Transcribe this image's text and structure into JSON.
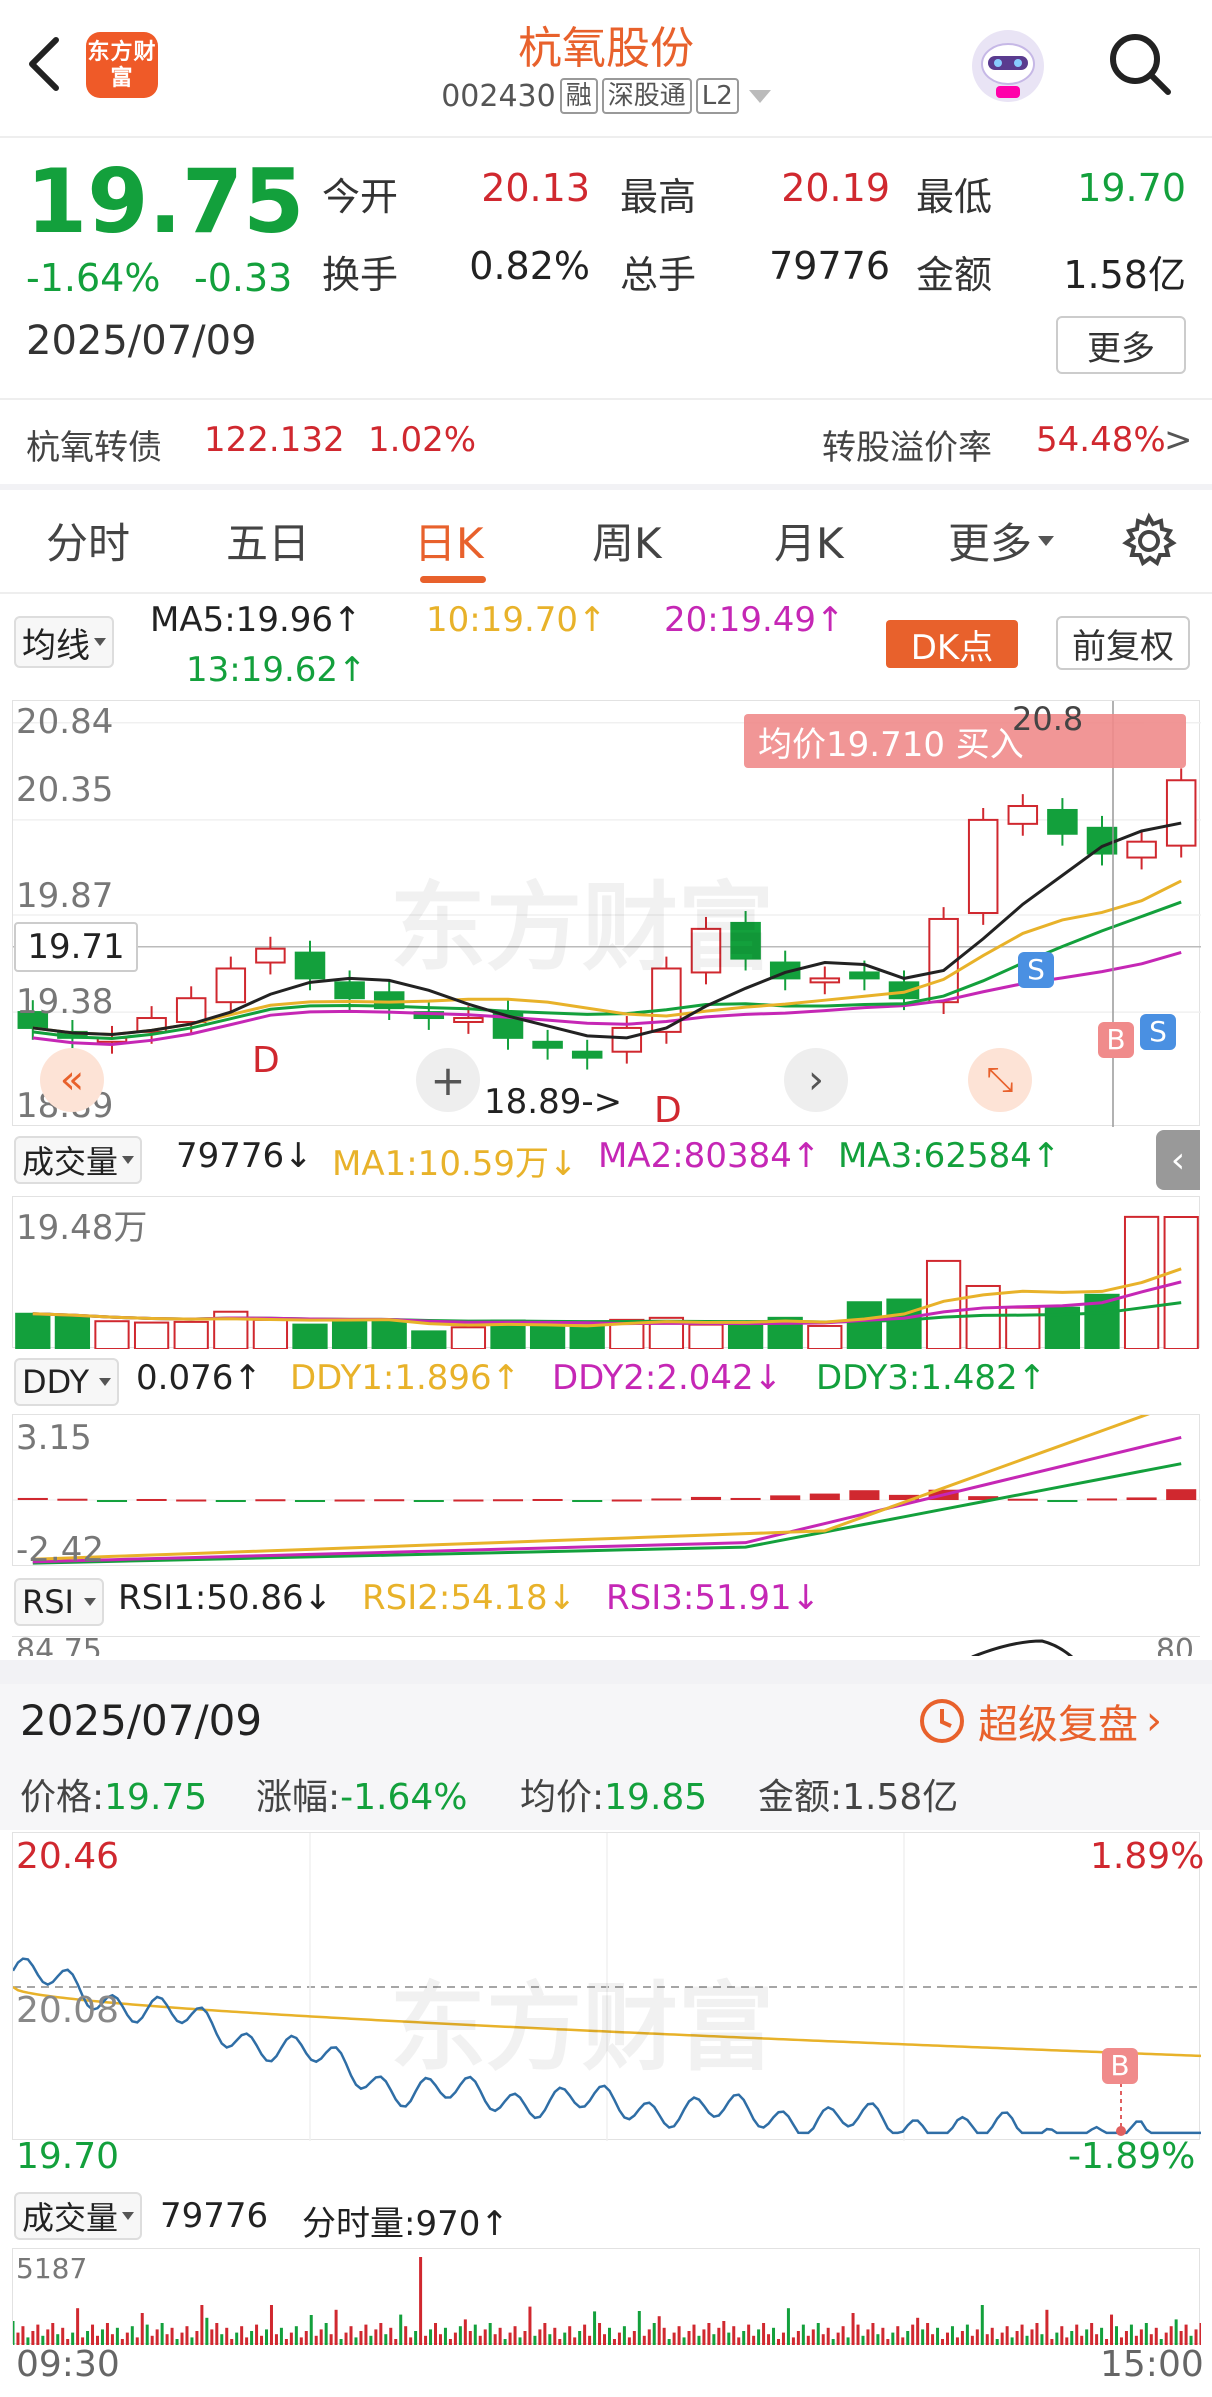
{
  "header": {
    "title": "杭氧股份",
    "code": "002430",
    "tags": [
      "融",
      "深股通",
      "L2"
    ],
    "logo_text": "东方财富"
  },
  "quote": {
    "price": "19.75",
    "change_pct": "-1.64%",
    "change": "-0.33",
    "date": "2025/07/09",
    "open_label": "今开",
    "open": "20.13",
    "high_label": "最高",
    "high": "20.19",
    "low_label": "最低",
    "low": "19.70",
    "turnover_label": "换手",
    "turnover": "0.82%",
    "volume_label": "总手",
    "volume": "79776",
    "amount_label": "金额",
    "amount": "1.58亿",
    "more": "更多"
  },
  "bond": {
    "name": "杭氧转债",
    "price": "122.132",
    "change": "1.02%",
    "premium_label": "转股溢价率",
    "premium": "54.48%",
    "arrow": ">"
  },
  "tabs": [
    "分时",
    "五日",
    "日K",
    "周K",
    "月K",
    "更多"
  ],
  "kline": {
    "indicator": "均线",
    "ma5": "MA5:19.96↑",
    "ma10": "10:19.70↑",
    "ma20": "20:19.49↑",
    "ma13": "13:19.62↑",
    "dk": "DK点",
    "adjust": "前复权",
    "avg_label": "均价19.710  买入",
    "top_partial": "20.8",
    "y_labels": [
      "20.84",
      "20.35",
      "19.87",
      "19.38",
      "18.89"
    ],
    "current": "19.71",
    "min_label": "18.89->",
    "buy_mark": "B",
    "sell_mark": "S",
    "d_mark": "D",
    "closes": [
      19.3,
      19.25,
      19.25,
      19.35,
      19.45,
      19.6,
      19.7,
      19.55,
      19.45,
      19.4,
      19.35,
      19.35,
      19.25,
      19.2,
      19.15,
      19.3,
      19.6,
      19.8,
      19.65,
      19.55,
      19.55,
      19.55,
      19.45,
      19.85,
      20.35,
      20.42,
      20.28,
      20.18,
      20.24,
      20.55
    ]
  },
  "volume": {
    "label": "成交量",
    "value": "79776↓",
    "ma1": "MA1:10.59万↓",
    "ma2": "MA2:80384↑",
    "ma3": "MA3:62584↑",
    "max": "19.48万"
  },
  "ddy": {
    "label": "DDY",
    "value": "0.076↑",
    "d1": "DDY1:1.896↑",
    "d2": "DDY2:2.042↓",
    "d3": "DDY3:1.482↑",
    "top": "3.15",
    "bottom": "-2.42"
  },
  "rsi": {
    "label": "RSI",
    "r1": "RSI1:50.86↓",
    "r2": "RSI2:54.18↓",
    "r3": "RSI3:51.91↓",
    "top_left": "84.75",
    "top_right": "80"
  },
  "detail": {
    "date": "2025/07/09",
    "replay": "超级复盘",
    "price_label": "价格:",
    "price": "19.75",
    "chg_label": "涨幅:",
    "chg": "-1.64%",
    "avg_label": "均价:",
    "avg": "19.85",
    "amt_label": "金额:",
    "amt": "1.58亿"
  },
  "intraday": {
    "high": "20.46",
    "high_pct": "1.89%",
    "mid": "20.08",
    "low": "19.70",
    "low_pct": "-1.89%",
    "buy": "B"
  },
  "intraday_vol": {
    "label": "成交量",
    "value": "79776",
    "tick_label": "分时量:970↑",
    "max": "5187",
    "start": "09:30",
    "end": "15:00"
  },
  "watermark": "东方财富",
  "colors": {
    "up": "#d0282f",
    "down": "#13a03c",
    "accent": "#e8612c",
    "ma5": "#222222",
    "ma10": "#e8b22a",
    "ma20": "#c527b5",
    "ma13": "#13a03c",
    "line": "#2f6ea6"
  }
}
